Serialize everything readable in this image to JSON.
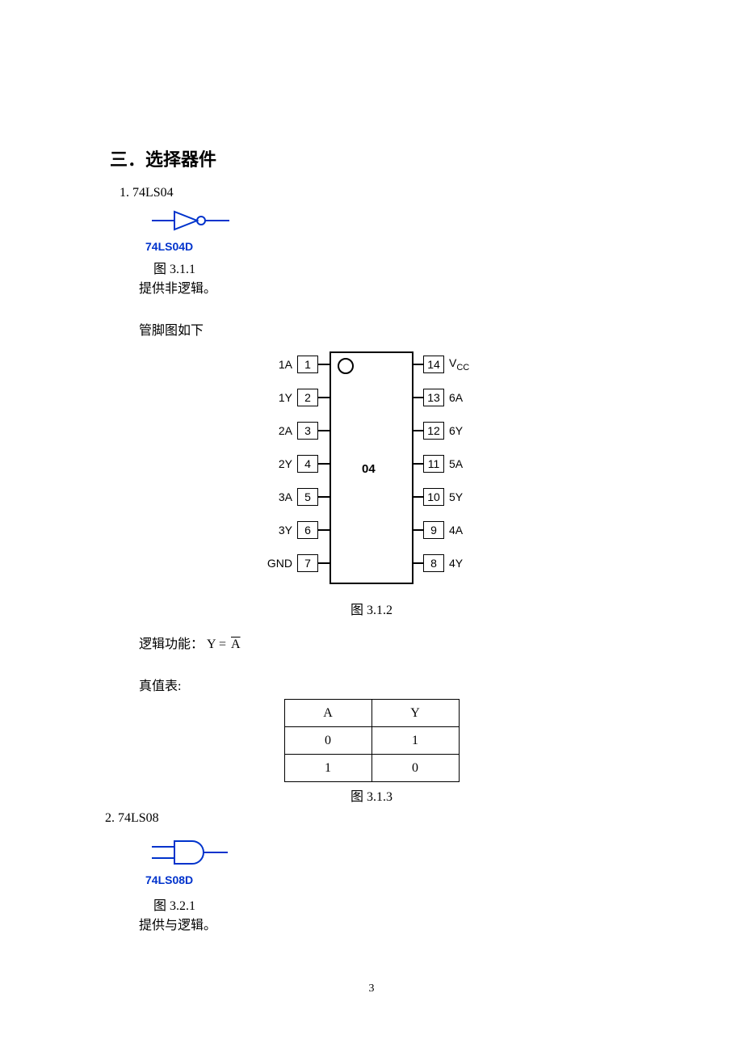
{
  "heading": "三．选择器件",
  "item1": {
    "title": "1. 74LS04",
    "gate_label": "74LS04D",
    "caption1": "图 3.1.1",
    "desc": "提供非逻辑。",
    "pinout_intro": "管脚图如下",
    "chip_name": "04",
    "left_pins": [
      {
        "label": "1A",
        "num": "1"
      },
      {
        "label": "1Y",
        "num": "2"
      },
      {
        "label": "2A",
        "num": "3"
      },
      {
        "label": "2Y",
        "num": "4"
      },
      {
        "label": "3A",
        "num": "5"
      },
      {
        "label": "3Y",
        "num": "6"
      },
      {
        "label": "GND",
        "num": "7"
      }
    ],
    "right_pins": [
      {
        "num": "14",
        "label": "V",
        "sub": "CC"
      },
      {
        "num": "13",
        "label": "6A"
      },
      {
        "num": "12",
        "label": "6Y"
      },
      {
        "num": "11",
        "label": "5A"
      },
      {
        "num": "10",
        "label": "5Y"
      },
      {
        "num": "9",
        "label": "4A"
      },
      {
        "num": "8",
        "label": "4Y"
      }
    ],
    "caption2": "图 3.1.2",
    "logic_label": "逻辑功能：",
    "logic_expr_prefix": "Y = ",
    "logic_expr_over": "A",
    "truth_label": "真值表:",
    "truth_header_a": "A",
    "truth_header_y": "Y",
    "truth_rows": [
      {
        "a": "0",
        "y": "1"
      },
      {
        "a": "1",
        "y": "0"
      }
    ],
    "caption3": "图 3.1.3"
  },
  "item2": {
    "title": "2. 74LS08",
    "gate_label": "74LS08D",
    "caption1": "图 3.2.1",
    "desc": "提供与逻辑。"
  },
  "page_number": "3"
}
